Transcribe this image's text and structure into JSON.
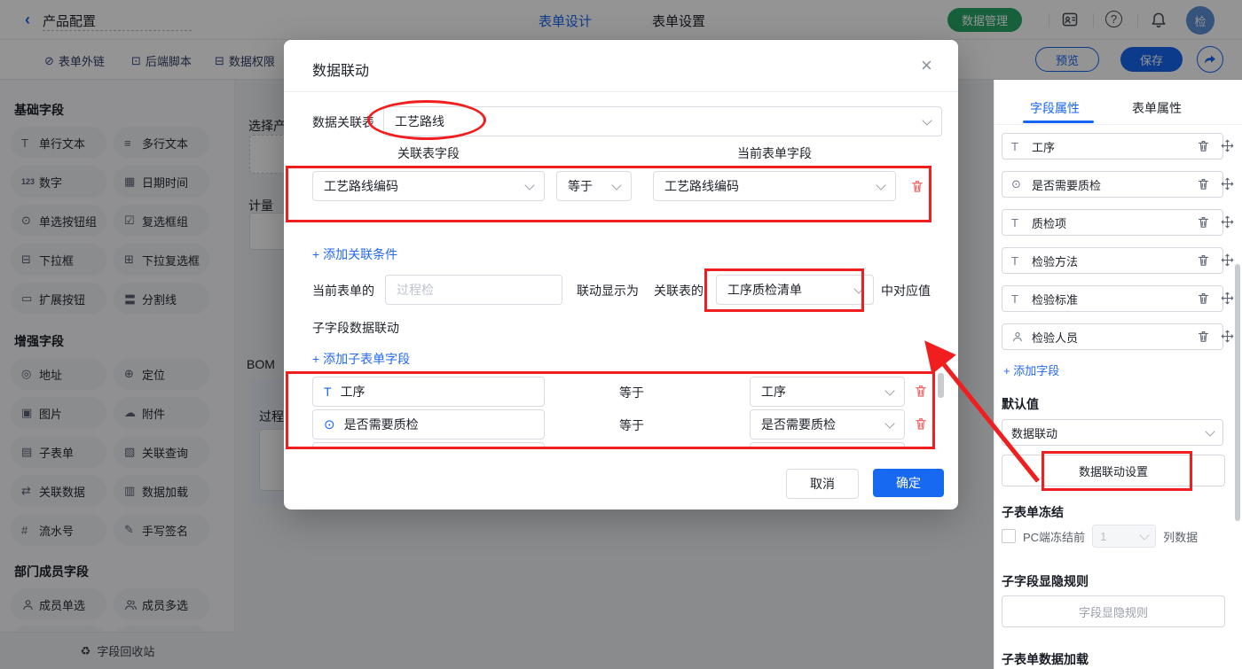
{
  "colors": {
    "primary": "#1766f2",
    "annotation_red": "#f01e1e",
    "success_green": "#27a567",
    "trash_red": "#f25f5f"
  },
  "topbar": {
    "back_label": "产品配置",
    "tabs": [
      {
        "label": "表单设计",
        "active": true
      },
      {
        "label": "表单设置",
        "active": false
      }
    ],
    "data_manage_label": "数据管理",
    "icon_names": [
      "address-book",
      "help",
      "bell"
    ],
    "avatar_text": "检"
  },
  "toolbar": {
    "items": [
      {
        "icon": "link",
        "label": "表单外链"
      },
      {
        "icon": "code",
        "label": "后端脚本"
      },
      {
        "icon": "grid",
        "label": "数据权限"
      }
    ],
    "preview_label": "预览",
    "save_label": "保存",
    "share_icon": "share-arrow"
  },
  "sidebar": {
    "sections": [
      {
        "title": "基础字段",
        "items": [
          {
            "icon": "T",
            "label": "单行文本"
          },
          {
            "icon": "multiline",
            "label": "多行文本"
          },
          {
            "icon": "num",
            "label": "数字"
          },
          {
            "icon": "calendar",
            "label": "日期时间"
          },
          {
            "icon": "radio",
            "label": "单选按钮组"
          },
          {
            "icon": "checkbox",
            "label": "复选框组"
          },
          {
            "icon": "select",
            "label": "下拉框"
          },
          {
            "icon": "multiselect",
            "label": "下拉复选框"
          },
          {
            "icon": "button",
            "label": "扩展按钮"
          },
          {
            "icon": "divider",
            "label": "分割线"
          }
        ]
      },
      {
        "title": "增强字段",
        "items": [
          {
            "icon": "address",
            "label": "地址"
          },
          {
            "icon": "location",
            "label": "定位"
          },
          {
            "icon": "image",
            "label": "图片"
          },
          {
            "icon": "cloud",
            "label": "附件"
          },
          {
            "icon": "subform",
            "label": "子表单"
          },
          {
            "icon": "query",
            "label": "关联查询"
          },
          {
            "icon": "linkdata",
            "label": "关联数据"
          },
          {
            "icon": "chart",
            "label": "数据加载"
          },
          {
            "icon": "serial",
            "label": "流水号"
          },
          {
            "icon": "pen",
            "label": "手写签名"
          }
        ]
      },
      {
        "title": "部门成员字段",
        "items": [
          {
            "icon": "person",
            "label": "成员单选"
          },
          {
            "icon": "persons",
            "label": "成员多选"
          }
        ]
      }
    ],
    "recycle_label": "字段回收站"
  },
  "canvas": {
    "field1_label": "选择产",
    "field2_label": "计量",
    "bom_label": "BOM",
    "process_label": "过程检"
  },
  "modal": {
    "title": "数据联动",
    "close_icon": "×",
    "relation_table_label": "数据关联表",
    "relation_table_value": "工艺路线",
    "col_left": "关联表字段",
    "col_right": "当前表单字段",
    "condition": {
      "left": "工艺路线编码",
      "op": "等于",
      "right": "工艺路线编码"
    },
    "add_condition_label": "+ 添加关联条件",
    "current_form_label": "当前表单的",
    "current_form_placeholder": "过程检",
    "display_as_label": "联动显示为",
    "related_table_label": "关联表的",
    "related_field_value": "工序质检清单",
    "corresponding_label": "中对应值",
    "subfield_title": "子字段数据联动",
    "add_subfield_label": "+ 添加子表单字段",
    "sub_rows": [
      {
        "icon": "T",
        "field": "工序",
        "op": "等于",
        "value": "工序"
      },
      {
        "icon": "radio",
        "field": "是否需要质检",
        "op": "等于",
        "value": "是否需要质检"
      }
    ],
    "cancel_label": "取消",
    "ok_label": "确定"
  },
  "panel": {
    "tabs": [
      {
        "label": "字段属性",
        "active": true
      },
      {
        "label": "表单属性",
        "active": false
      }
    ],
    "fields": [
      {
        "icon": "T",
        "label": "工序"
      },
      {
        "icon": "radio",
        "label": "是否需要质检"
      },
      {
        "icon": "T",
        "label": "质检项"
      },
      {
        "icon": "T",
        "label": "检验方法"
      },
      {
        "icon": "T",
        "label": "检验标准"
      },
      {
        "icon": "person",
        "label": "检验人员"
      }
    ],
    "add_field_label": "+ 添加字段",
    "default_value_title": "默认值",
    "default_value": "数据联动",
    "linkage_button_label": "数据联动设置",
    "freeze_title": "子表单冻结",
    "freeze_prefix": "PC端冻结前",
    "freeze_count": "1",
    "freeze_suffix": "列数据",
    "visibility_title": "子字段显隐规则",
    "visibility_button_label": "字段显隐规则",
    "data_load_title": "子表单数据加载"
  }
}
